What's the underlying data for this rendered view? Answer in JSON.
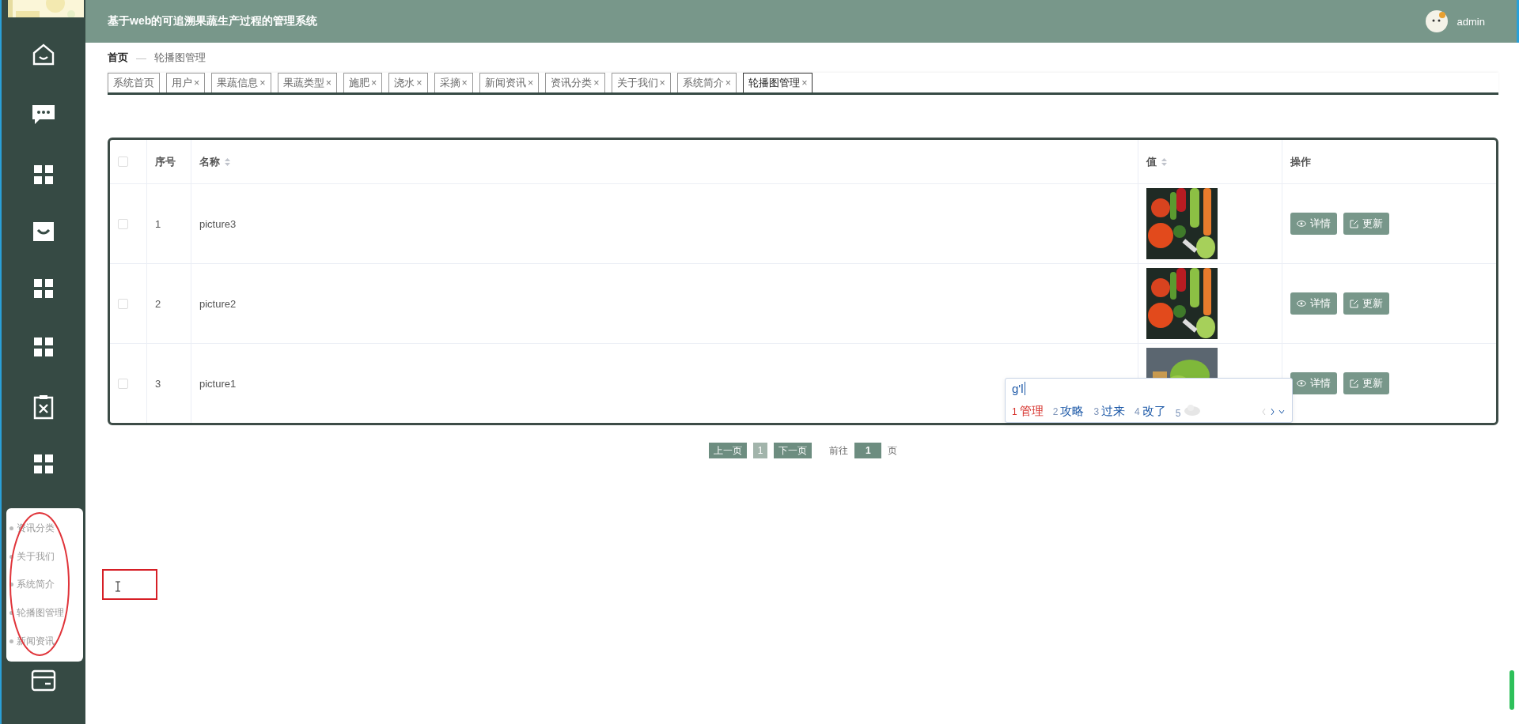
{
  "header": {
    "title": "基于web的可追溯果蔬生产过程的管理系统",
    "user": "admin"
  },
  "sidebar": {
    "logo": {
      "kind": "picture"
    },
    "submenu": [
      {
        "label": "资讯分类"
      },
      {
        "label": "关于我们"
      },
      {
        "label": "系统简介"
      },
      {
        "label": "轮播图管理"
      },
      {
        "label": "新闻资讯"
      }
    ]
  },
  "breadcrumb": {
    "home": "首页",
    "separator": "—",
    "current": "轮播图管理"
  },
  "tabs": [
    {
      "label": "系统首页",
      "selected": false
    },
    {
      "label": "用户",
      "close": "×",
      "selected": false
    },
    {
      "label": "果蔬信息",
      "close": "×",
      "selected": false
    },
    {
      "label": "果蔬类型",
      "close": "×",
      "selected": false
    },
    {
      "label": "施肥",
      "close": "×",
      "selected": false
    },
    {
      "label": "浇水",
      "close": "×",
      "selected": false
    },
    {
      "label": "采摘",
      "close": "×",
      "selected": false
    },
    {
      "label": "新闻资讯",
      "close": "×",
      "selected": false
    },
    {
      "label": "资讯分类",
      "close": "×",
      "selected": false
    },
    {
      "label": "关于我们",
      "close": "×",
      "selected": false
    },
    {
      "label": "系统简介",
      "close": "×",
      "selected": false
    },
    {
      "label": "轮播图管理",
      "close": "×",
      "selected": true
    }
  ],
  "table": {
    "all_checked": false,
    "columns": [
      {
        "label": "序号",
        "sortable": false
      },
      {
        "label": "名称",
        "sortable": true
      },
      {
        "label": "值",
        "sortable": true
      },
      {
        "label": "操作",
        "sortable": false
      }
    ],
    "rows": [
      {
        "checked": false,
        "index": "1",
        "name": "picture3",
        "value": {
          "kind": "picture"
        },
        "actions": [
          "详情",
          "更新"
        ]
      },
      {
        "checked": false,
        "index": "2",
        "name": "picture2",
        "value": {
          "kind": "picture"
        },
        "actions": [
          "详情",
          "更新"
        ]
      },
      {
        "checked": false,
        "index": "3",
        "name": "picture1",
        "value": {
          "kind": "picture"
        },
        "actions": [
          "详情",
          "更新"
        ]
      }
    ]
  },
  "pagination": {
    "prev": "上一页",
    "current": "1",
    "next": "下一页",
    "goto_label": "前往",
    "goto_value": "1",
    "goto_suffix": "页"
  },
  "ime": {
    "composition": "g'l",
    "candidates": [
      {
        "number": "1",
        "text": "管理",
        "selected": true
      },
      {
        "number": "2",
        "text": "攻略",
        "selected": false
      },
      {
        "number": "3",
        "text": "过来",
        "selected": false
      },
      {
        "number": "4",
        "text": "改了",
        "selected": false
      },
      {
        "number": "5",
        "kind": "picture",
        "selected": false
      }
    ]
  }
}
